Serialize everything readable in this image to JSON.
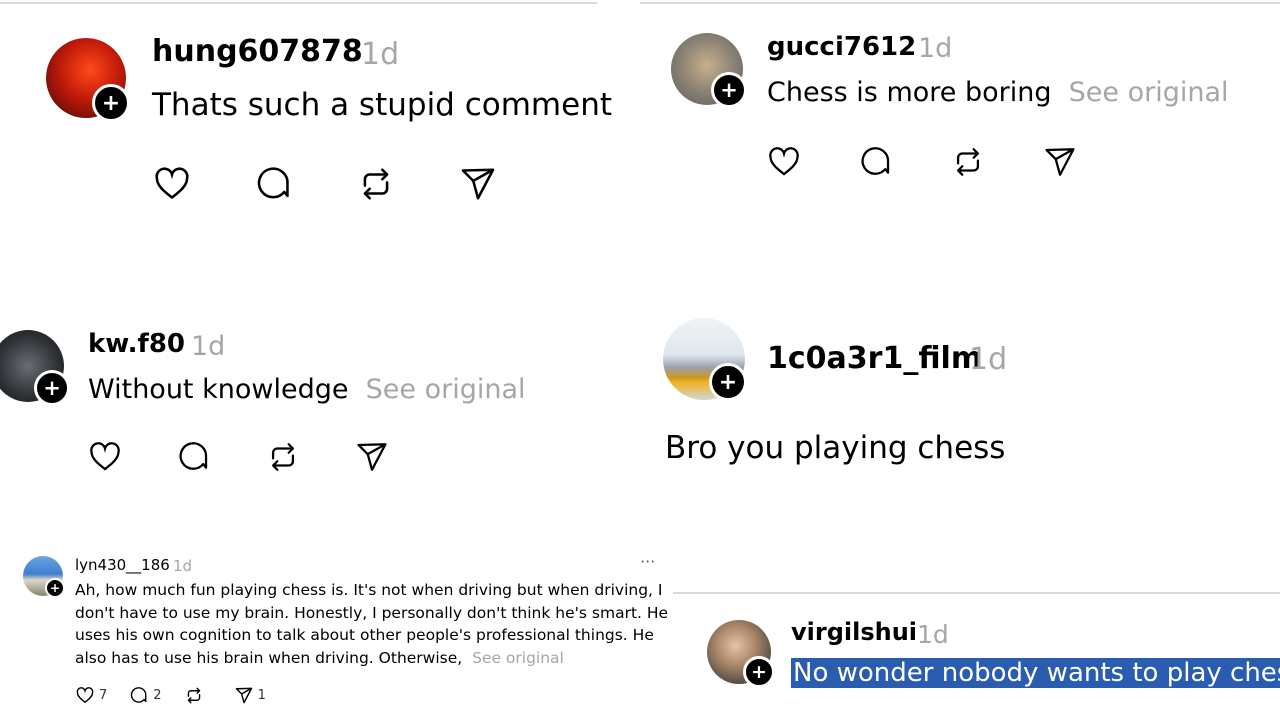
{
  "posts": [
    {
      "username": "hung607878",
      "time": "1d",
      "text": "Thats such a stupid comment",
      "see_original": ""
    },
    {
      "username": "gucci7612",
      "time": "1d",
      "text": "Chess is more boring",
      "see_original": "See original"
    },
    {
      "username": "kw.f80",
      "time": "1d",
      "text": "Without knowledge",
      "see_original": "See original"
    },
    {
      "username": "1c0a3r1_film",
      "time": "1d",
      "text": "Bro you playing chess",
      "see_original": ""
    },
    {
      "username": "lyn430__186",
      "time": "1d",
      "text": "Ah, how much fun playing chess is. It's not when driving but when driving, I don't have to use my brain. Honestly, I personally don't think he's smart. He uses his own cognition to talk about other people's professional things. He also has to use his brain when driving. Otherwise,",
      "see_original": "See original",
      "more": "···",
      "counts": {
        "likes": "7",
        "comments": "2",
        "shares": "1"
      }
    },
    {
      "username": "virgilshui",
      "time": "1d",
      "text": "No wonder nobody wants to play chess",
      "see_original": ""
    }
  ],
  "icons": [
    "heart-icon",
    "comment-icon",
    "repost-icon",
    "share-icon",
    "plus-icon",
    "more-icon"
  ],
  "colors": {
    "muted": "#a6a6a6",
    "highlight": "#2a5db0"
  }
}
